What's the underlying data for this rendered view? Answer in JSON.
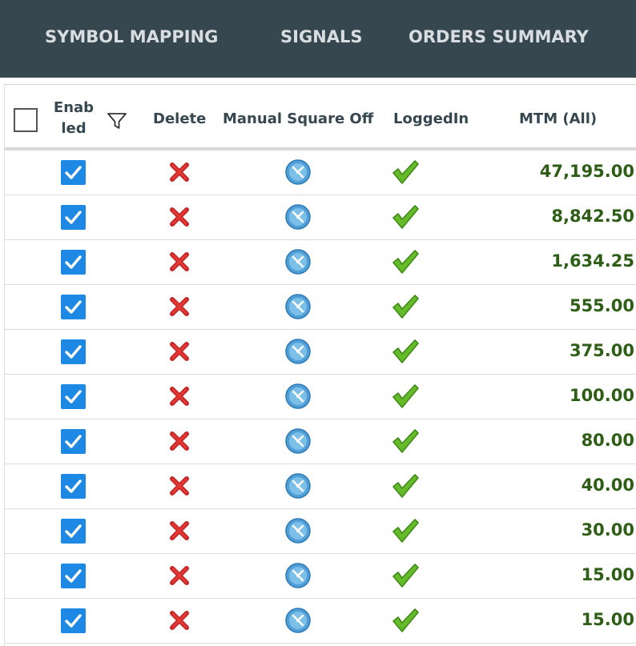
{
  "nav": {
    "tabs": [
      "SYMBOL MAPPING",
      "SIGNALS",
      "ORDERS SUMMARY"
    ]
  },
  "grid": {
    "headers": {
      "enabled": "Enab led",
      "delete": "Delete",
      "manual_square_off": "Manual Square Off",
      "logged_in": "LoggedIn",
      "mtm": "MTM (All)"
    },
    "rows": [
      {
        "enabled": true,
        "logged_in": true,
        "mtm": "47,195.00"
      },
      {
        "enabled": true,
        "logged_in": true,
        "mtm": "8,842.50"
      },
      {
        "enabled": true,
        "logged_in": true,
        "mtm": "1,634.25"
      },
      {
        "enabled": true,
        "logged_in": true,
        "mtm": "555.00"
      },
      {
        "enabled": true,
        "logged_in": true,
        "mtm": "375.00"
      },
      {
        "enabled": true,
        "logged_in": true,
        "mtm": "100.00"
      },
      {
        "enabled": true,
        "logged_in": true,
        "mtm": "80.00"
      },
      {
        "enabled": true,
        "logged_in": true,
        "mtm": "40.00"
      },
      {
        "enabled": true,
        "logged_in": true,
        "mtm": "30.00"
      },
      {
        "enabled": true,
        "logged_in": true,
        "mtm": "15.00"
      },
      {
        "enabled": true,
        "logged_in": true,
        "mtm": "15.00"
      }
    ]
  },
  "icons": {
    "filter": "filter-icon",
    "delete": "delete-x-icon",
    "square_off": "square-off-clock-icon",
    "logged_in": "check-mark-icon"
  },
  "colors": {
    "topbar": "#37474f",
    "checkbox": "#1e88e5",
    "delete": "#c62828",
    "check": "#66bb2a",
    "mtm_text": "#2e5e16"
  }
}
